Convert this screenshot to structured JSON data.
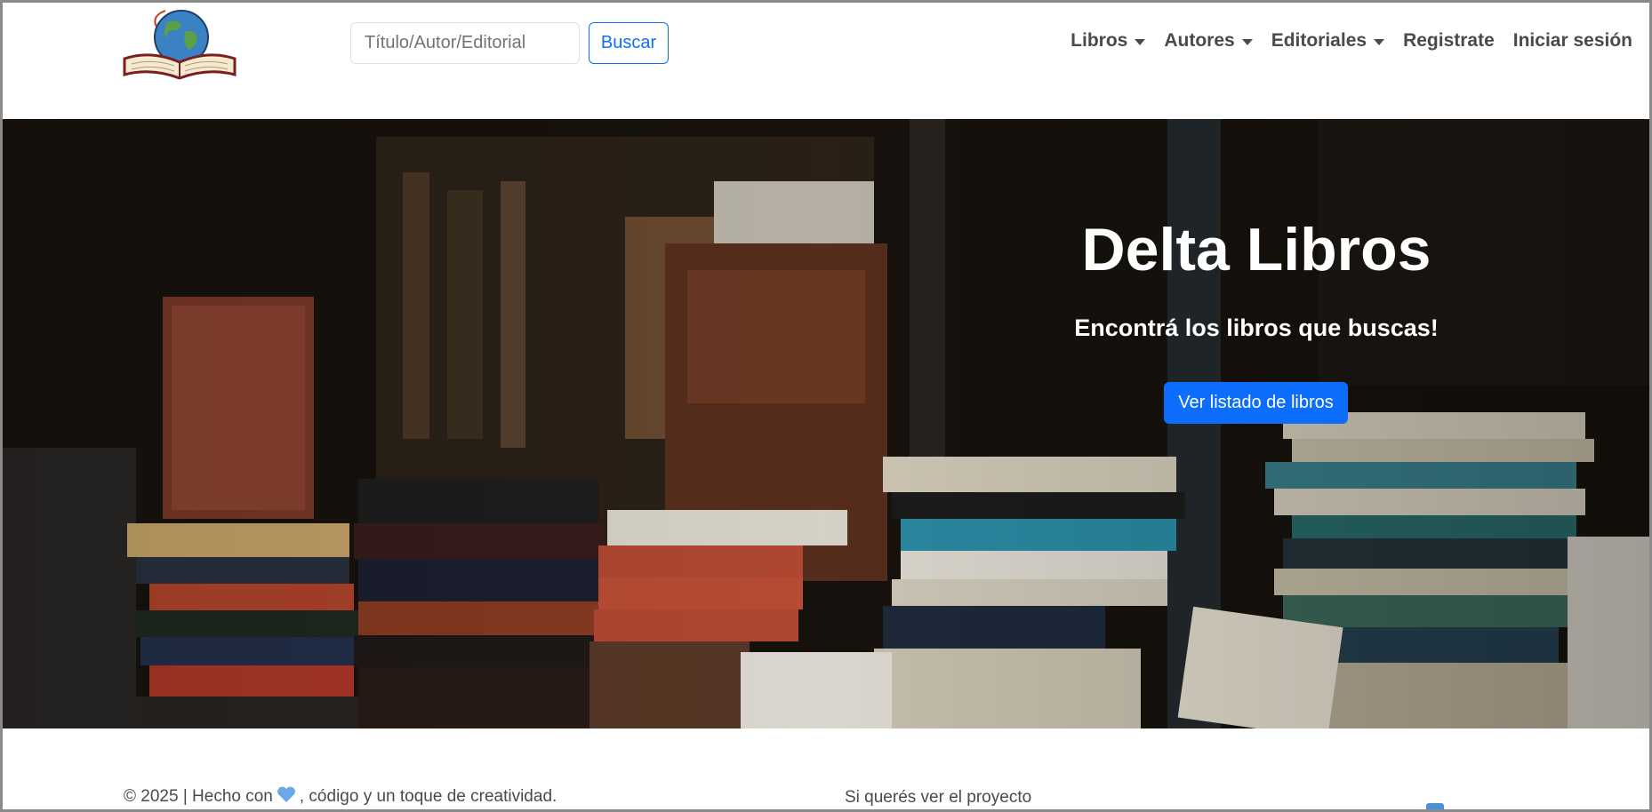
{
  "search": {
    "placeholder": "Título/Autor/Editorial",
    "button_label": "Buscar"
  },
  "nav": {
    "items": [
      {
        "label": "Libros",
        "dropdown": true
      },
      {
        "label": "Autores",
        "dropdown": true
      },
      {
        "label": "Editoriales",
        "dropdown": true
      },
      {
        "label": "Registrate",
        "dropdown": false
      },
      {
        "label": "Iniciar sesión",
        "dropdown": false
      }
    ]
  },
  "hero": {
    "title": "Delta Libros",
    "subtitle": "Encontrá los libros que buscas!",
    "button_label": "Ver listado de libros"
  },
  "footer": {
    "copyright_prefix": "© 2025 | Hecho con",
    "copyright_suffix": ", código y un toque de creatividad.",
    "project_text": "Si querés ver el proyecto"
  },
  "colors": {
    "primary": "#0d6efd",
    "nav_text": "#4a4a4a",
    "hero_text": "#ffffff"
  }
}
